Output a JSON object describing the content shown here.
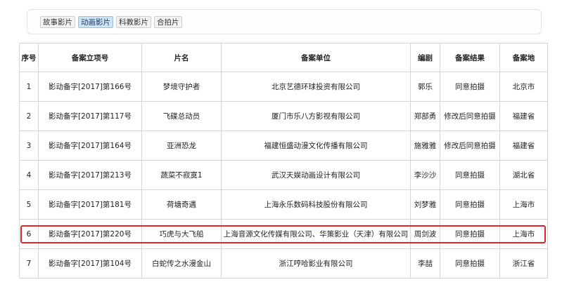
{
  "tabs": [
    "故事影片",
    "动画影片",
    "科教影片",
    "合拍片"
  ],
  "active_tab_index": 1,
  "headers": [
    "序号",
    "备案立项号",
    "片名",
    "备案单位",
    "编剧",
    "备案结果",
    "备案地"
  ],
  "rows": [
    [
      "1",
      "影动备字[2017]第166号",
      "梦境守护者",
      "北京艺德环球投资有限公司",
      "郭乐",
      "同意拍摄",
      "北京市"
    ],
    [
      "2",
      "影动备字[2017]第117号",
      "飞碟总动员",
      "厦门市乐八方影视有限公司",
      "郑部勇",
      "修改后同意拍摄",
      "福建省"
    ],
    [
      "3",
      "影动备字[2017]第164号",
      "亚洲恐龙",
      "福建恒盛动漫文化传播有限公司",
      "施雅雅",
      "修改后同意拍摄",
      "福建省"
    ],
    [
      "4",
      "影动备字[2017]第213号",
      "蔬菜不寂寞1",
      "武汉天娱动画设计有限公司",
      "李沙沙",
      "同意拍摄",
      "湖北省"
    ],
    [
      "5",
      "影动备字[2017]第181号",
      "荷塘奇遇",
      "上海永乐数码科技股份有限公司",
      "刘梦雅",
      "同意拍摄",
      "上海市"
    ],
    [
      "6",
      "影动备字[2017]第220号",
      "巧虎与大飞船",
      "上海音源文化传媒有限公司、华策影业（天津）有限公司",
      "周剑波",
      "同意拍摄",
      "上海市"
    ],
    [
      "7",
      "影动备字[2017]第104号",
      "白蛇传之水漫金山",
      "浙江哼哈影业有限公司",
      "李喆",
      "同意拍摄",
      "浙江省"
    ]
  ],
  "highlighted_row_index": 5,
  "colors": {
    "highlight_border": "#e0262b",
    "active_tab": "#cfe3f7",
    "grid_line": "#d6d6d6"
  }
}
